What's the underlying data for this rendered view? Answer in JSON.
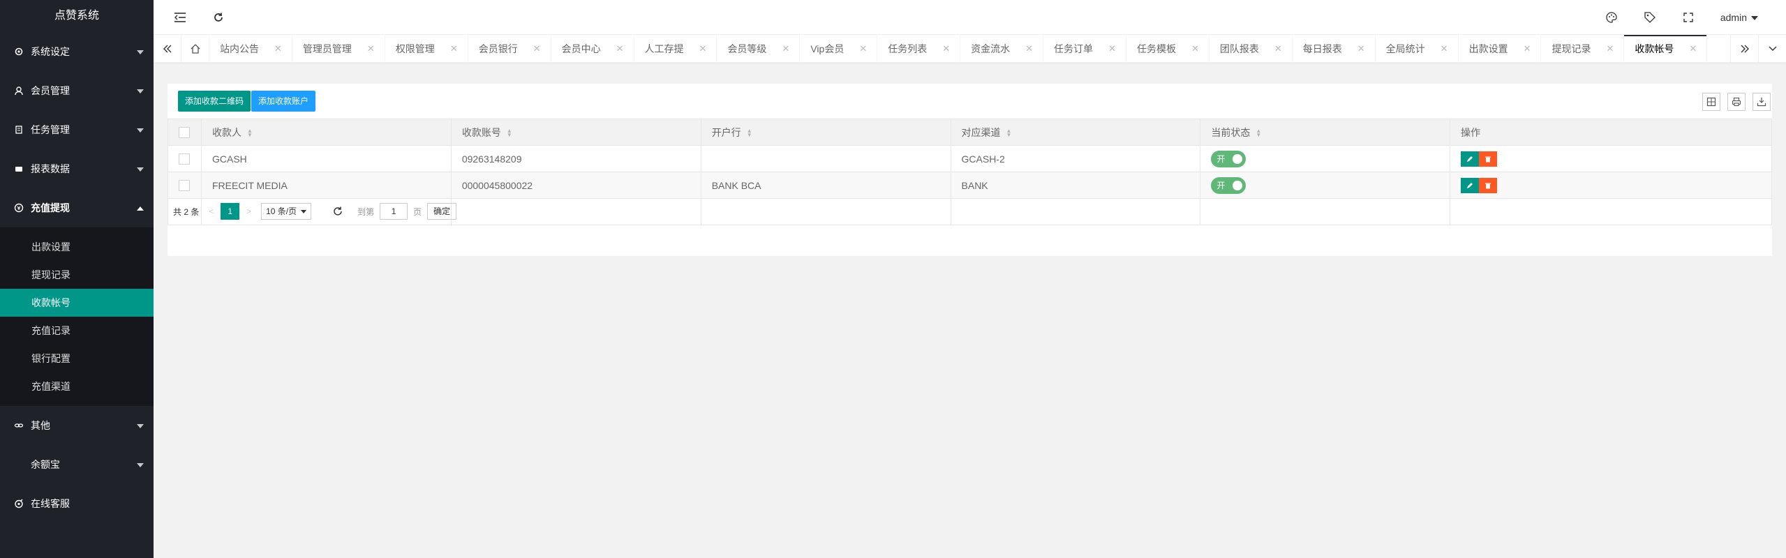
{
  "app": {
    "title": "点赞系统"
  },
  "sidebar": {
    "items": [
      {
        "label": "系统设定",
        "icon": "gear-icon"
      },
      {
        "label": "会员管理",
        "icon": "user-icon"
      },
      {
        "label": "任务管理",
        "icon": "doc-icon"
      },
      {
        "label": "报表数据",
        "icon": "chart-icon"
      },
      {
        "label": "充值提现",
        "icon": "money-icon",
        "expanded": true,
        "children": [
          "出款设置",
          "提现记录",
          "收款帐号",
          "充值记录",
          "银行配置",
          "充值渠道"
        ],
        "active": "收款帐号"
      },
      {
        "label": "其他",
        "icon": "link-icon"
      },
      {
        "label": "余额宝",
        "icon": ""
      },
      {
        "label": "在线客服",
        "icon": "support-icon"
      }
    ]
  },
  "header": {
    "user": "admin"
  },
  "tabs": [
    "站内公告",
    "管理员管理",
    "权限管理",
    "会员银行",
    "会员中心",
    "人工存提",
    "会员等级",
    "Vip会员",
    "任务列表",
    "资金流水",
    "任务订单",
    "任务模板",
    "团队报表",
    "每日报表",
    "全局统计",
    "出款设置",
    "提现记录",
    "收款帐号"
  ],
  "active_tab": "收款帐号",
  "toolbar": {
    "add_qr": "添加收款二维码",
    "add_account": "添加收款账户"
  },
  "table": {
    "headers": [
      "收款人",
      "收款账号",
      "开户行",
      "对应渠道",
      "当前状态",
      "操作"
    ],
    "rows": [
      {
        "payee": "GCASH",
        "account": "09263148209",
        "bank": "",
        "channel": "GCASH-2",
        "status": "开"
      },
      {
        "payee": "FREECIT MEDIA",
        "account": "0000045800022",
        "bank": "BANK BCA",
        "channel": "BANK",
        "status": "开"
      }
    ]
  },
  "pager": {
    "total": "共 2 条",
    "page": "1",
    "per_page": "10 条/页",
    "goto_label": "到第",
    "goto_value": "1",
    "page_unit": "页",
    "confirm": "确定"
  },
  "colors": {
    "sidebar_bg": "#20222a",
    "accent": "#009688",
    "blue": "#1e9fff",
    "switch": "#5fb878",
    "danger": "#ff5722"
  }
}
